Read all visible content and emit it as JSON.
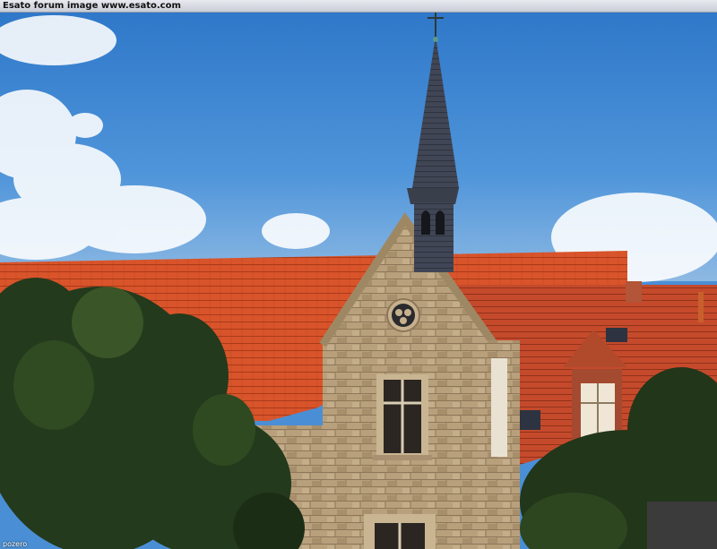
{
  "banner": {
    "text": "Esato forum image www.esato.com"
  },
  "credit": {
    "text": "pozero"
  },
  "photo": {
    "subject": "church gable with spire and red tiled roofs",
    "colors": {
      "sky": "#3f87d2",
      "roof": "#d9542a",
      "stone": "#b59e7d",
      "spire": "#3f4452",
      "trees": "#243a1c"
    }
  }
}
